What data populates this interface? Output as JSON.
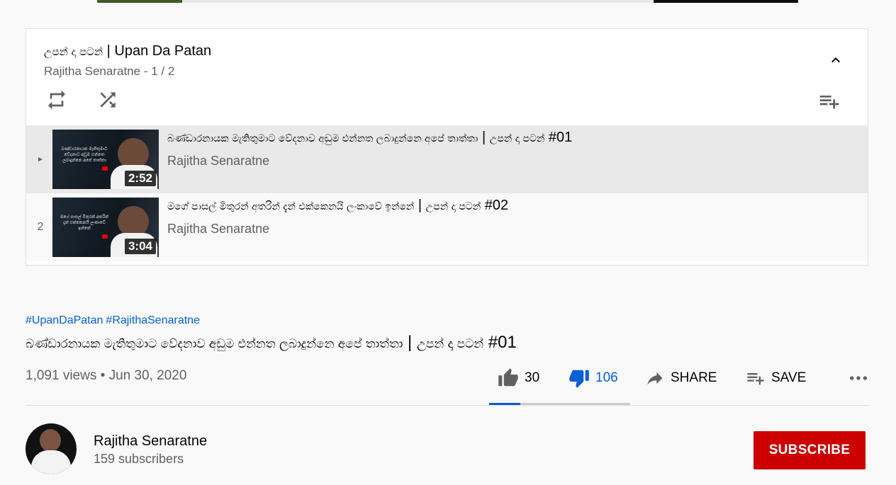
{
  "playlist": {
    "title_si": "උපන් දා පටන්",
    "title_sep": " | ",
    "title_en": "Upan Da Patan",
    "owner": "Rajitha Senaratne",
    "position": " - 1 / 2",
    "icons": {
      "collapse": "chevron-up-icon",
      "loop": "loop-icon",
      "shuffle": "shuffle-icon",
      "add_to_queue": "playlist-add-icon"
    },
    "items": [
      {
        "index": "►",
        "thumb_text": "බණ්ඩාරනායක මැතිතුමාට වේදනාව අඩුම එන්නත ලබාදුන්නෙ අපේ තාත්තා",
        "duration": "2:52",
        "title_si": "බණ්ඩාරනායක මැතිතුමාට වේදනාව අඩුම එන්නත ලබාදුන්නෙ අපේ තාත්තා",
        "title_sep": " | ",
        "title_si2": "උපන් දා පටන්",
        "title_num": " #01",
        "channel": "Rajitha Senaratne"
      },
      {
        "index": "2",
        "thumb_text": "මගේ පාසල් මිතුරන් අතරින් දැන් එක්කෙනයි ලංකාවේ ඉන්නේ",
        "duration": "3:04",
        "title_si": "මගේ පාසල් මිතුරන් අතරින් දැන් එක්කෙනයි ලංකාවේ ඉන්නේ",
        "title_sep": " | ",
        "title_si2": "උපන් දා පටන්",
        "title_num": " #02",
        "channel": "Rajitha Senaratne"
      }
    ]
  },
  "video": {
    "hashtags": [
      "#UpanDaPatan",
      "#RajithaSenaratne"
    ],
    "title_si": "බණ්ඩාරනායක මැතිතුමාට වේදනාව අඩුම එන්නත ලබාදුන්නෙ අපේ තාත්තා",
    "title_sep": " | ",
    "title_si2": "උපන් දා පටන්",
    "title_num": " #01",
    "views": "1,091 views",
    "dot": " • ",
    "date": "Jun 30, 2020"
  },
  "actions": {
    "likes": "30",
    "dislikes": "106",
    "share": "SHARE",
    "save": "SAVE",
    "like_ratio": 0.22,
    "icons": {
      "like": "thumbs-up-icon",
      "dislike": "thumbs-down-icon",
      "share": "share-icon",
      "save": "playlist-add-icon",
      "more": "more-horizontal-icon"
    }
  },
  "channel": {
    "name": "Rajitha Senaratne",
    "subscribers": "159 subscribers",
    "subscribe": "SUBSCRIBE"
  },
  "colors": {
    "accent_blue": "#065fd4",
    "subscribe_red": "#cc0000",
    "secondary_text": "#606060"
  }
}
